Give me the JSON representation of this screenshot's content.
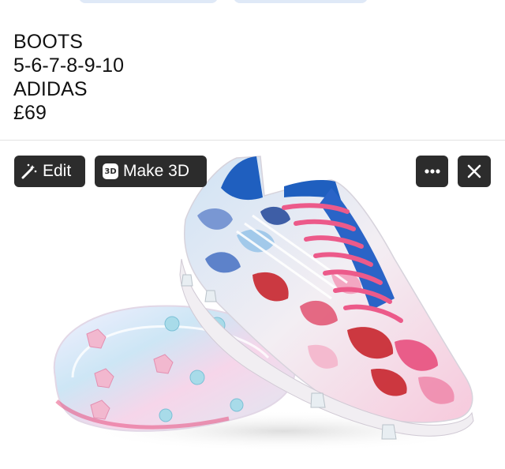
{
  "post": {
    "lines": [
      "BOOTS",
      "5-6-7-8-9-10",
      "ADIDAS",
      "£69"
    ]
  },
  "toolbar": {
    "edit_label": "Edit",
    "make3d_label": "Make 3D",
    "make3d_badge": "3D",
    "more_icon": "ellipsis-icon",
    "close_icon": "close-icon",
    "edit_icon": "magic-wand-icon"
  },
  "colors": {
    "chip_bg": "#2c2c2c",
    "boot_pink": "#e8507f",
    "boot_blue": "#1f5fbf",
    "boot_red": "#c8262e"
  }
}
